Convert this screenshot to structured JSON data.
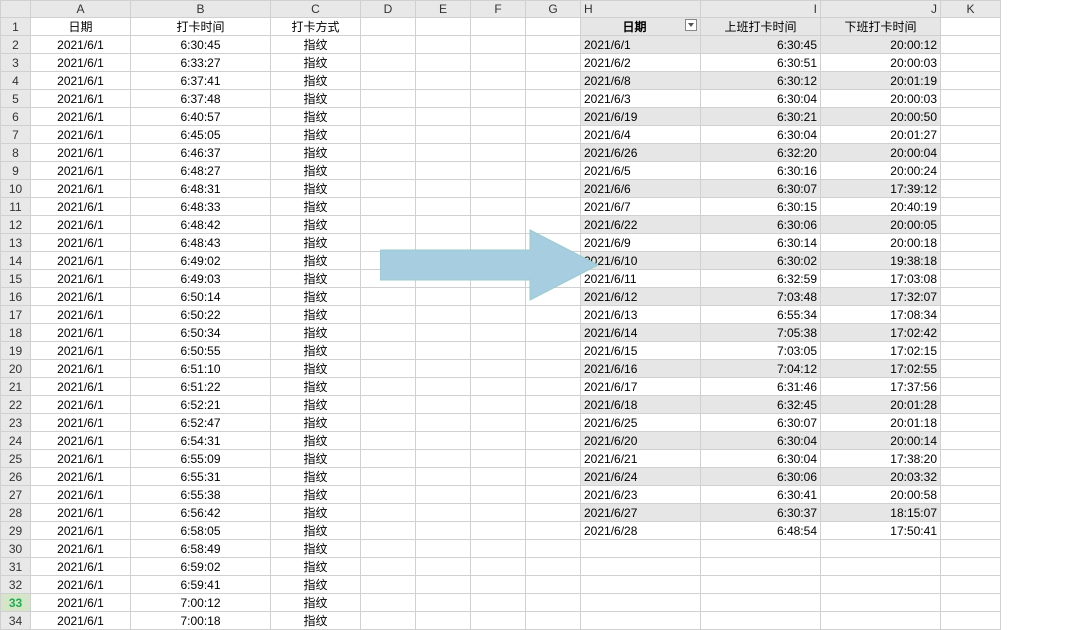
{
  "columns": [
    "A",
    "B",
    "C",
    "D",
    "E",
    "F",
    "G",
    "H",
    "I",
    "J",
    "K"
  ],
  "headerRow": {
    "A": "日期",
    "B": "打卡时间",
    "C": "打卡方式",
    "H": "日期",
    "I": "上班打卡时间",
    "J": "下班打卡时间"
  },
  "leftData": [
    [
      "2021/6/1",
      "6:30:45",
      "指纹"
    ],
    [
      "2021/6/1",
      "6:33:27",
      "指纹"
    ],
    [
      "2021/6/1",
      "6:37:41",
      "指纹"
    ],
    [
      "2021/6/1",
      "6:37:48",
      "指纹"
    ],
    [
      "2021/6/1",
      "6:40:57",
      "指纹"
    ],
    [
      "2021/6/1",
      "6:45:05",
      "指纹"
    ],
    [
      "2021/6/1",
      "6:46:37",
      "指纹"
    ],
    [
      "2021/6/1",
      "6:48:27",
      "指纹"
    ],
    [
      "2021/6/1",
      "6:48:31",
      "指纹"
    ],
    [
      "2021/6/1",
      "6:48:33",
      "指纹"
    ],
    [
      "2021/6/1",
      "6:48:42",
      "指纹"
    ],
    [
      "2021/6/1",
      "6:48:43",
      "指纹"
    ],
    [
      "2021/6/1",
      "6:49:02",
      "指纹"
    ],
    [
      "2021/6/1",
      "6:49:03",
      "指纹"
    ],
    [
      "2021/6/1",
      "6:50:14",
      "指纹"
    ],
    [
      "2021/6/1",
      "6:50:22",
      "指纹"
    ],
    [
      "2021/6/1",
      "6:50:34",
      "指纹"
    ],
    [
      "2021/6/1",
      "6:50:55",
      "指纹"
    ],
    [
      "2021/6/1",
      "6:51:10",
      "指纹"
    ],
    [
      "2021/6/1",
      "6:51:22",
      "指纹"
    ],
    [
      "2021/6/1",
      "6:52:21",
      "指纹"
    ],
    [
      "2021/6/1",
      "6:52:47",
      "指纹"
    ],
    [
      "2021/6/1",
      "6:54:31",
      "指纹"
    ],
    [
      "2021/6/1",
      "6:55:09",
      "指纹"
    ],
    [
      "2021/6/1",
      "6:55:31",
      "指纹"
    ],
    [
      "2021/6/1",
      "6:55:38",
      "指纹"
    ],
    [
      "2021/6/1",
      "6:56:42",
      "指纹"
    ],
    [
      "2021/6/1",
      "6:58:05",
      "指纹"
    ],
    [
      "2021/6/1",
      "6:58:49",
      "指纹"
    ],
    [
      "2021/6/1",
      "6:59:02",
      "指纹"
    ],
    [
      "2021/6/1",
      "6:59:41",
      "指纹"
    ],
    [
      "2021/6/1",
      "7:00:12",
      "指纹"
    ],
    [
      "2021/6/1",
      "7:00:18",
      "指纹"
    ]
  ],
  "rightData": [
    [
      "2021/6/1",
      "6:30:45",
      "20:00:12"
    ],
    [
      "2021/6/2",
      "6:30:51",
      "20:00:03"
    ],
    [
      "2021/6/8",
      "6:30:12",
      "20:01:19"
    ],
    [
      "2021/6/3",
      "6:30:04",
      "20:00:03"
    ],
    [
      "2021/6/19",
      "6:30:21",
      "20:00:50"
    ],
    [
      "2021/6/4",
      "6:30:04",
      "20:01:27"
    ],
    [
      "2021/6/26",
      "6:32:20",
      "20:00:04"
    ],
    [
      "2021/6/5",
      "6:30:16",
      "20:00:24"
    ],
    [
      "2021/6/6",
      "6:30:07",
      "17:39:12"
    ],
    [
      "2021/6/7",
      "6:30:15",
      "20:40:19"
    ],
    [
      "2021/6/22",
      "6:30:06",
      "20:00:05"
    ],
    [
      "2021/6/9",
      "6:30:14",
      "20:00:18"
    ],
    [
      "2021/6/10",
      "6:30:02",
      "19:38:18"
    ],
    [
      "2021/6/11",
      "6:32:59",
      "17:03:08"
    ],
    [
      "2021/6/12",
      "7:03:48",
      "17:32:07"
    ],
    [
      "2021/6/13",
      "6:55:34",
      "17:08:34"
    ],
    [
      "2021/6/14",
      "7:05:38",
      "17:02:42"
    ],
    [
      "2021/6/15",
      "7:03:05",
      "17:02:15"
    ],
    [
      "2021/6/16",
      "7:04:12",
      "17:02:55"
    ],
    [
      "2021/6/17",
      "6:31:46",
      "17:37:56"
    ],
    [
      "2021/6/18",
      "6:32:45",
      "20:01:28"
    ],
    [
      "2021/6/25",
      "6:30:07",
      "20:01:18"
    ],
    [
      "2021/6/20",
      "6:30:04",
      "20:00:14"
    ],
    [
      "2021/6/21",
      "6:30:04",
      "17:38:20"
    ],
    [
      "2021/6/24",
      "6:30:06",
      "20:03:32"
    ],
    [
      "2021/6/23",
      "6:30:41",
      "20:00:58"
    ],
    [
      "2021/6/27",
      "6:30:37",
      "18:15:07"
    ],
    [
      "2021/6/28",
      "6:48:54",
      "17:50:41"
    ]
  ],
  "selectedRow": 33,
  "numRows": 34
}
